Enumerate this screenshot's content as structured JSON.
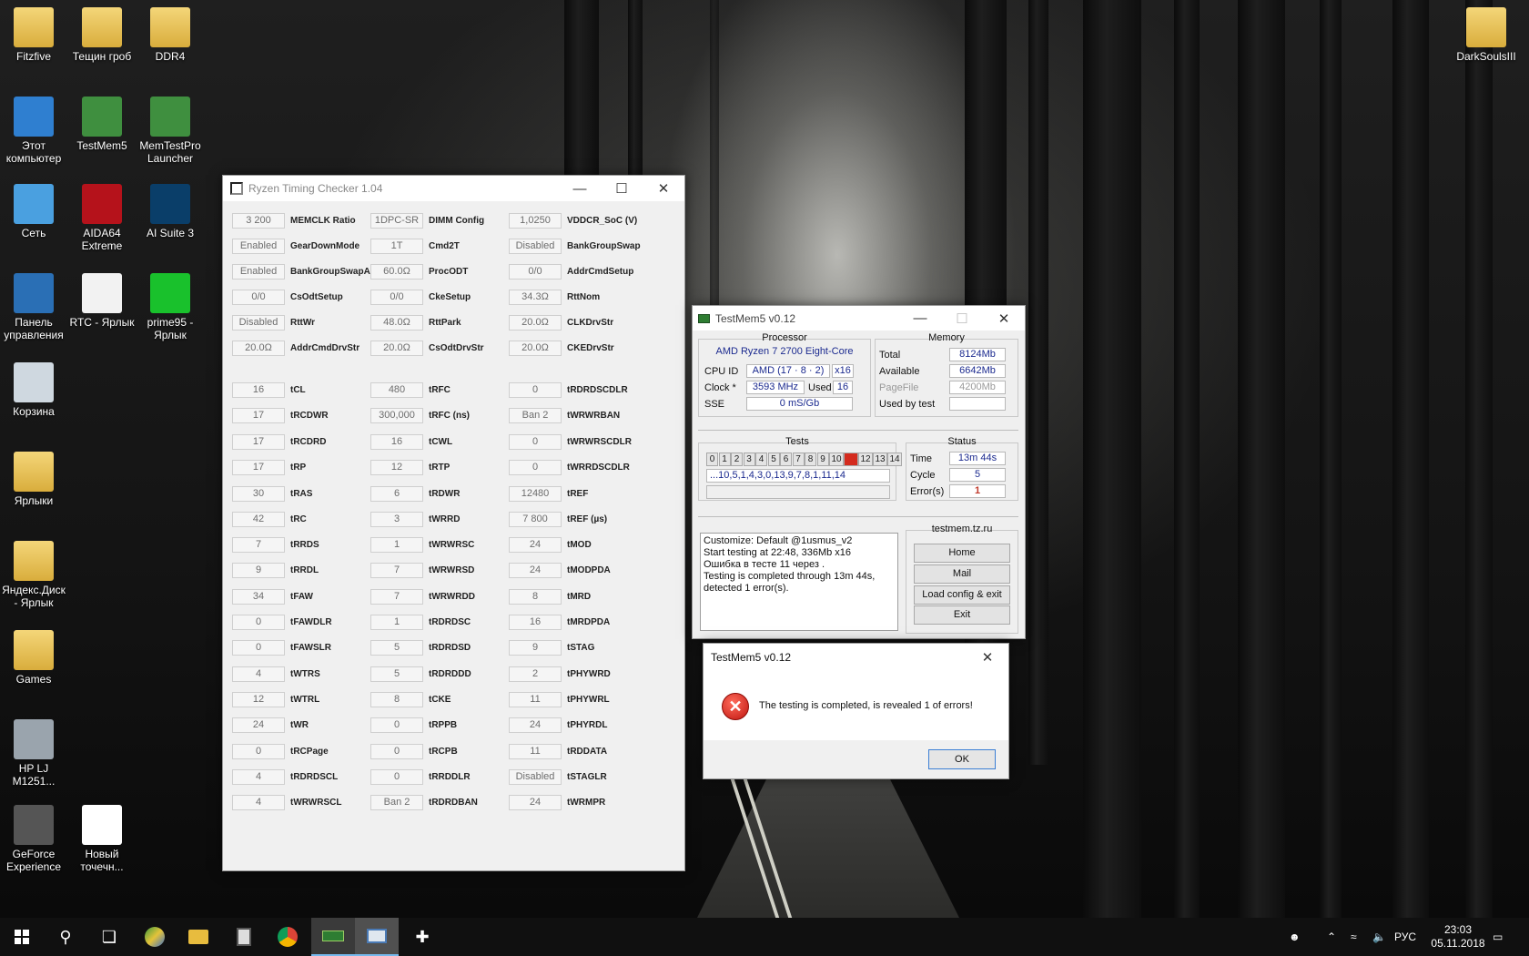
{
  "desktop": {
    "icons": [
      {
        "label": "Fitzfive",
        "icon": "folder-user-icon"
      },
      {
        "label": "Тещин гроб",
        "icon": "folder-icon"
      },
      {
        "label": "DDR4",
        "icon": "folder-icon"
      },
      {
        "label": "Этот компьютер",
        "icon": "computer-icon"
      },
      {
        "label": "TestMem5",
        "icon": "ram-icon"
      },
      {
        "label": "MemTestPro Launcher",
        "icon": "ram-icon"
      },
      {
        "label": "Сеть",
        "icon": "network-icon"
      },
      {
        "label": "AIDA64 Extreme",
        "icon": "aida64-icon"
      },
      {
        "label": "AI Suite 3",
        "icon": "ai-suite-icon"
      },
      {
        "label": "Панель управления",
        "icon": "control-panel-icon"
      },
      {
        "label": "RTC - Ярлык",
        "icon": "rtc-icon"
      },
      {
        "label": "prime95 - Ярлык",
        "icon": "prime95-icon"
      },
      {
        "label": "Корзина",
        "icon": "recycle-bin-icon"
      },
      {
        "label": "Ярлыки",
        "icon": "folder-icon"
      },
      {
        "label": "Яндекс.Диск - Ярлык",
        "icon": "folder-icon"
      },
      {
        "label": "Games",
        "icon": "folder-icon"
      },
      {
        "label": "HP LJ M1251...",
        "icon": "scanner-icon"
      },
      {
        "label": "GeForce Experience",
        "icon": "geforce-icon"
      },
      {
        "label": "Новый точечн...",
        "icon": "image-file-icon"
      },
      {
        "label": "DarkSoulsIII",
        "icon": "folder-icon"
      }
    ]
  },
  "rtc": {
    "title": "Ryzen Timing Checker 1.04",
    "col1": [
      {
        "v": "3 200",
        "n": "MEMCLK Ratio"
      },
      {
        "v": "Enabled",
        "n": "GearDownMode"
      },
      {
        "v": "Enabled",
        "n": "BankGroupSwapAlt"
      },
      {
        "v": "0/0",
        "n": "CsOdtSetup"
      },
      {
        "v": "Disabled",
        "n": "RttWr"
      },
      {
        "v": "20.0Ω",
        "n": "AddrCmdDrvStr"
      },
      {
        "v": "16",
        "n": "tCL"
      },
      {
        "v": "17",
        "n": "tRCDWR"
      },
      {
        "v": "17",
        "n": "tRCDRD"
      },
      {
        "v": "17",
        "n": "tRP"
      },
      {
        "v": "30",
        "n": "tRAS"
      },
      {
        "v": "42",
        "n": "tRC"
      },
      {
        "v": "7",
        "n": "tRRDS"
      },
      {
        "v": "9",
        "n": "tRRDL"
      },
      {
        "v": "34",
        "n": "tFAW"
      },
      {
        "v": "0",
        "n": "tFAWDLR"
      },
      {
        "v": "0",
        "n": "tFAWSLR"
      },
      {
        "v": "4",
        "n": "tWTRS"
      },
      {
        "v": "12",
        "n": "tWTRL"
      },
      {
        "v": "24",
        "n": "tWR"
      },
      {
        "v": "0",
        "n": "tRCPage"
      },
      {
        "v": "4",
        "n": "tRDRDSCL"
      },
      {
        "v": "4",
        "n": "tWRWRSCL"
      }
    ],
    "col2": [
      {
        "v": "1DPC-SR",
        "n": "DIMM Config"
      },
      {
        "v": "1T",
        "n": "Cmd2T"
      },
      {
        "v": "60.0Ω",
        "n": "ProcODT"
      },
      {
        "v": "0/0",
        "n": "CkeSetup"
      },
      {
        "v": "48.0Ω",
        "n": "RttPark"
      },
      {
        "v": "20.0Ω",
        "n": "CsOdtDrvStr"
      },
      {
        "v": "480",
        "n": "tRFC"
      },
      {
        "v": "300,000",
        "n": "tRFC (ns)"
      },
      {
        "v": "16",
        "n": "tCWL"
      },
      {
        "v": "12",
        "n": "tRTP"
      },
      {
        "v": "6",
        "n": "tRDWR"
      },
      {
        "v": "3",
        "n": "tWRRD"
      },
      {
        "v": "1",
        "n": "tWRWRSC"
      },
      {
        "v": "7",
        "n": "tWRWRSD"
      },
      {
        "v": "7",
        "n": "tWRWRDD"
      },
      {
        "v": "1",
        "n": "tRDRDSC"
      },
      {
        "v": "5",
        "n": "tRDRDSD"
      },
      {
        "v": "5",
        "n": "tRDRDDD"
      },
      {
        "v": "8",
        "n": "tCKE"
      },
      {
        "v": "0",
        "n": "tRPPB"
      },
      {
        "v": "0",
        "n": "tRCPB"
      },
      {
        "v": "0",
        "n": "tRRDDLR"
      },
      {
        "v": "Ban 2",
        "n": "tRDRDBAN"
      }
    ],
    "col3": [
      {
        "v": "1,0250",
        "n": "VDDCR_SoC (V)"
      },
      {
        "v": "Disabled",
        "n": "BankGroupSwap"
      },
      {
        "v": "0/0",
        "n": "AddrCmdSetup"
      },
      {
        "v": "34.3Ω",
        "n": "RttNom"
      },
      {
        "v": "20.0Ω",
        "n": "CLKDrvStr"
      },
      {
        "v": "20.0Ω",
        "n": "CKEDrvStr"
      },
      {
        "v": "0",
        "n": "tRDRDSCDLR"
      },
      {
        "v": "Ban 2",
        "n": "tWRWRBAN"
      },
      {
        "v": "0",
        "n": "tWRWRSCDLR"
      },
      {
        "v": "0",
        "n": "tWRRDSCDLR"
      },
      {
        "v": "12480",
        "n": "tREF"
      },
      {
        "v": "7 800",
        "n": "tREF (µs)"
      },
      {
        "v": "24",
        "n": "tMOD"
      },
      {
        "v": "24",
        "n": "tMODPDA"
      },
      {
        "v": "8",
        "n": "tMRD"
      },
      {
        "v": "16",
        "n": "tMRDPDA"
      },
      {
        "v": "9",
        "n": "tSTAG"
      },
      {
        "v": "2",
        "n": "tPHYWRD"
      },
      {
        "v": "11",
        "n": "tPHYWRL"
      },
      {
        "v": "24",
        "n": "tPHYRDL"
      },
      {
        "v": "11",
        "n": "tRDDATA"
      },
      {
        "v": "Disabled",
        "n": "tSTAGLR"
      },
      {
        "v": "24",
        "n": "tWRMPR"
      }
    ]
  },
  "tm5": {
    "title": "TestMem5 v0.12",
    "processor": {
      "title": "Processor",
      "name": "AMD Ryzen 7 2700 Eight-Core",
      "cpuid_label": "CPU ID",
      "cpuid": "AMD  (17 · 8 · 2)",
      "threads": "x16",
      "clock_label": "Clock *",
      "clock": "3593 MHz",
      "used_label": "Used",
      "used": "16",
      "sse_label": "SSE",
      "sse": "0 mS/Gb"
    },
    "memory": {
      "title": "Memory",
      "total_label": "Total",
      "total": "8124Mb",
      "available_label": "Available",
      "available": "6642Mb",
      "pagefile_label": "PageFile",
      "pagefile": "4200Mb",
      "usedbytest_label": "Used by test",
      "usedbytest": ""
    },
    "tests": {
      "title": "Tests",
      "numbers": [
        "0",
        "1",
        "2",
        "3",
        "4",
        "5",
        "6",
        "7",
        "8",
        "9",
        "10",
        "11",
        "12",
        "13",
        "14"
      ],
      "active": "11",
      "error_color": "#d42b1e",
      "sequence": "...10,5,1,4,3,0,13,9,7,8,1,11,14"
    },
    "status": {
      "title": "Status",
      "time_label": "Time",
      "time": "13m 44s",
      "cycle_label": "Cycle",
      "cycle": "5",
      "errors_label": "Error(s)",
      "errors": "1"
    },
    "log": [
      "Customize: Default @1usmus_v2",
      "Start testing at 22:48, 336Mb x16",
      "Ошибка в тесте 11 через .",
      "Testing is completed through 13m 44s,",
      "detected 1 error(s)."
    ],
    "links": {
      "title": "testmem.tz.ru",
      "home": "Home",
      "mail": "Mail",
      "load": "Load config & exit",
      "exit": "Exit"
    }
  },
  "dialog": {
    "title": "TestMem5 v0.12",
    "message": "The testing is completed, is revealed 1 of errors!",
    "ok": "OK"
  },
  "taskbar": {
    "items": [
      "start-icon",
      "search-icon",
      "task-view-icon",
      "maps-icon",
      "explorer-icon",
      "calculator-icon",
      "chrome-icon",
      "testmem5-icon",
      "rtc-icon",
      "snipping-icon"
    ],
    "lang": "РУС",
    "time": "23:03",
    "date": "05.11.2018"
  }
}
